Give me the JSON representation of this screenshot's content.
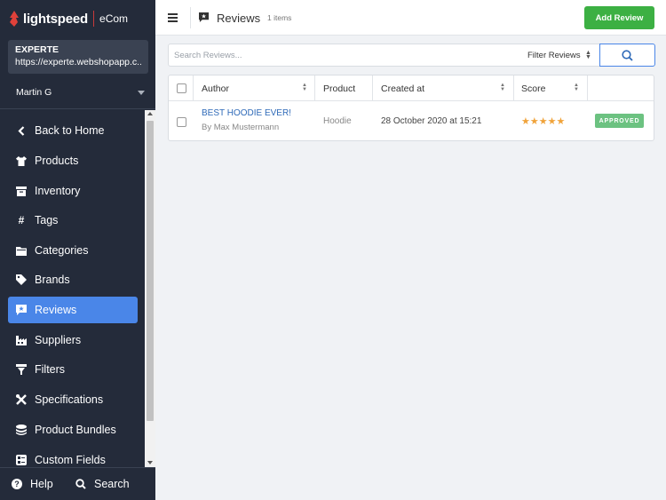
{
  "brand": {
    "name": "lightspeed",
    "product": "eCom"
  },
  "shop": {
    "name": "EXPERTE",
    "url": "https://experte.webshopapp.c..."
  },
  "user": {
    "name": "Martin G"
  },
  "nav": [
    {
      "label": "Back to Home",
      "icon": "chevron-left-icon"
    },
    {
      "label": "Products",
      "icon": "shirt-icon"
    },
    {
      "label": "Inventory",
      "icon": "box-icon"
    },
    {
      "label": "Tags",
      "icon": "hash-icon"
    },
    {
      "label": "Categories",
      "icon": "folder-icon"
    },
    {
      "label": "Brands",
      "icon": "tag-icon"
    },
    {
      "label": "Reviews",
      "icon": "review-icon",
      "active": true
    },
    {
      "label": "Suppliers",
      "icon": "factory-icon"
    },
    {
      "label": "Filters",
      "icon": "filter-icon"
    },
    {
      "label": "Specifications",
      "icon": "tools-icon"
    },
    {
      "label": "Product Bundles",
      "icon": "layers-icon"
    },
    {
      "label": "Custom Fields",
      "icon": "fields-icon"
    }
  ],
  "footer": {
    "help": "Help",
    "search": "Search"
  },
  "header": {
    "title": "Reviews",
    "count": "1 items",
    "add_button": "Add Review"
  },
  "search": {
    "placeholder": "Search Reviews...",
    "filter": "Filter Reviews"
  },
  "table": {
    "columns": [
      "Author",
      "Product",
      "Created at",
      "Score"
    ],
    "rows": [
      {
        "title": "BEST HOODIE EVER!",
        "author": "By Max Mustermann",
        "product": "Hoodie",
        "created": "28 October 2020 at 15:21",
        "score": "★★★★★",
        "status": "APPROVED"
      }
    ]
  },
  "colors": {
    "sidebar": "#242b3a",
    "active": "#4a86e8",
    "add": "#3cb043",
    "approved": "#6cc281",
    "star": "#f0a33a"
  }
}
